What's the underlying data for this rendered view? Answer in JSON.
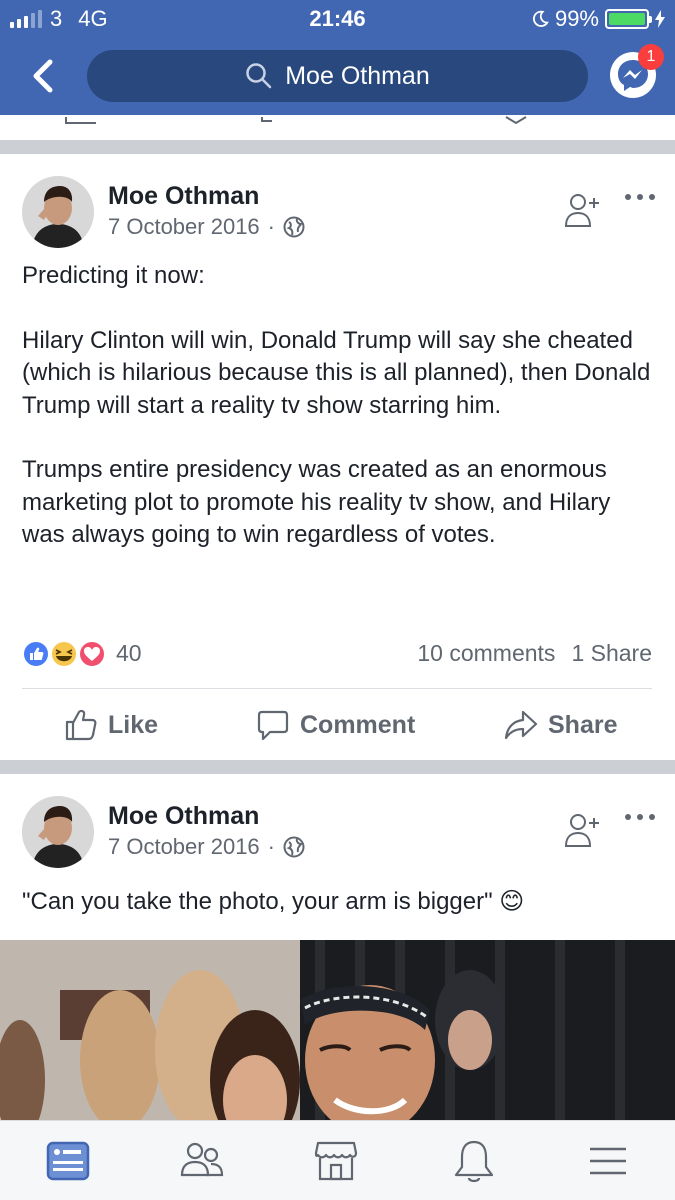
{
  "status_bar": {
    "carrier": "3",
    "network": "4G",
    "time": "21:46",
    "battery": "99%"
  },
  "nav": {
    "search_text": "Moe Othman",
    "messenger_badge": "1"
  },
  "colors": {
    "brand": "#4267b2",
    "search_bg": "#29487d",
    "badge": "#fa3e3e",
    "divider": "#cccfd4",
    "secondary_text": "#606770",
    "active_tab": "#4267b2"
  },
  "posts": [
    {
      "author": "Moe Othman",
      "date": "7 October 2016",
      "separator": "·",
      "paragraphs": [
        "Predicting it now:",
        "Hilary Clinton will win, Donald Trump will say she cheated (which is hilarious because this is all planned), then Donald Trump will start a reality tv show starring him.",
        "Trumps entire presidency was created as an enormous marketing plot to promote his reality tv show, and Hilary was always going to win regardless of votes."
      ],
      "reactions": [
        "like-icon",
        "haha-icon",
        "love-icon"
      ],
      "reaction_count": "40",
      "comments": "10 comments",
      "shares": "1 Share",
      "actions": {
        "like": "Like",
        "comment": "Comment",
        "share": "Share"
      }
    },
    {
      "author": "Moe Othman",
      "date": "7 October 2016",
      "separator": "·",
      "text": "\"Can you take the photo, your arm is bigger\" 😊"
    }
  ],
  "tabbar": {
    "tabs": [
      "news-feed-icon",
      "friends-icon",
      "marketplace-icon",
      "notifications-icon",
      "menu-icon"
    ],
    "active": "news-feed-icon"
  }
}
